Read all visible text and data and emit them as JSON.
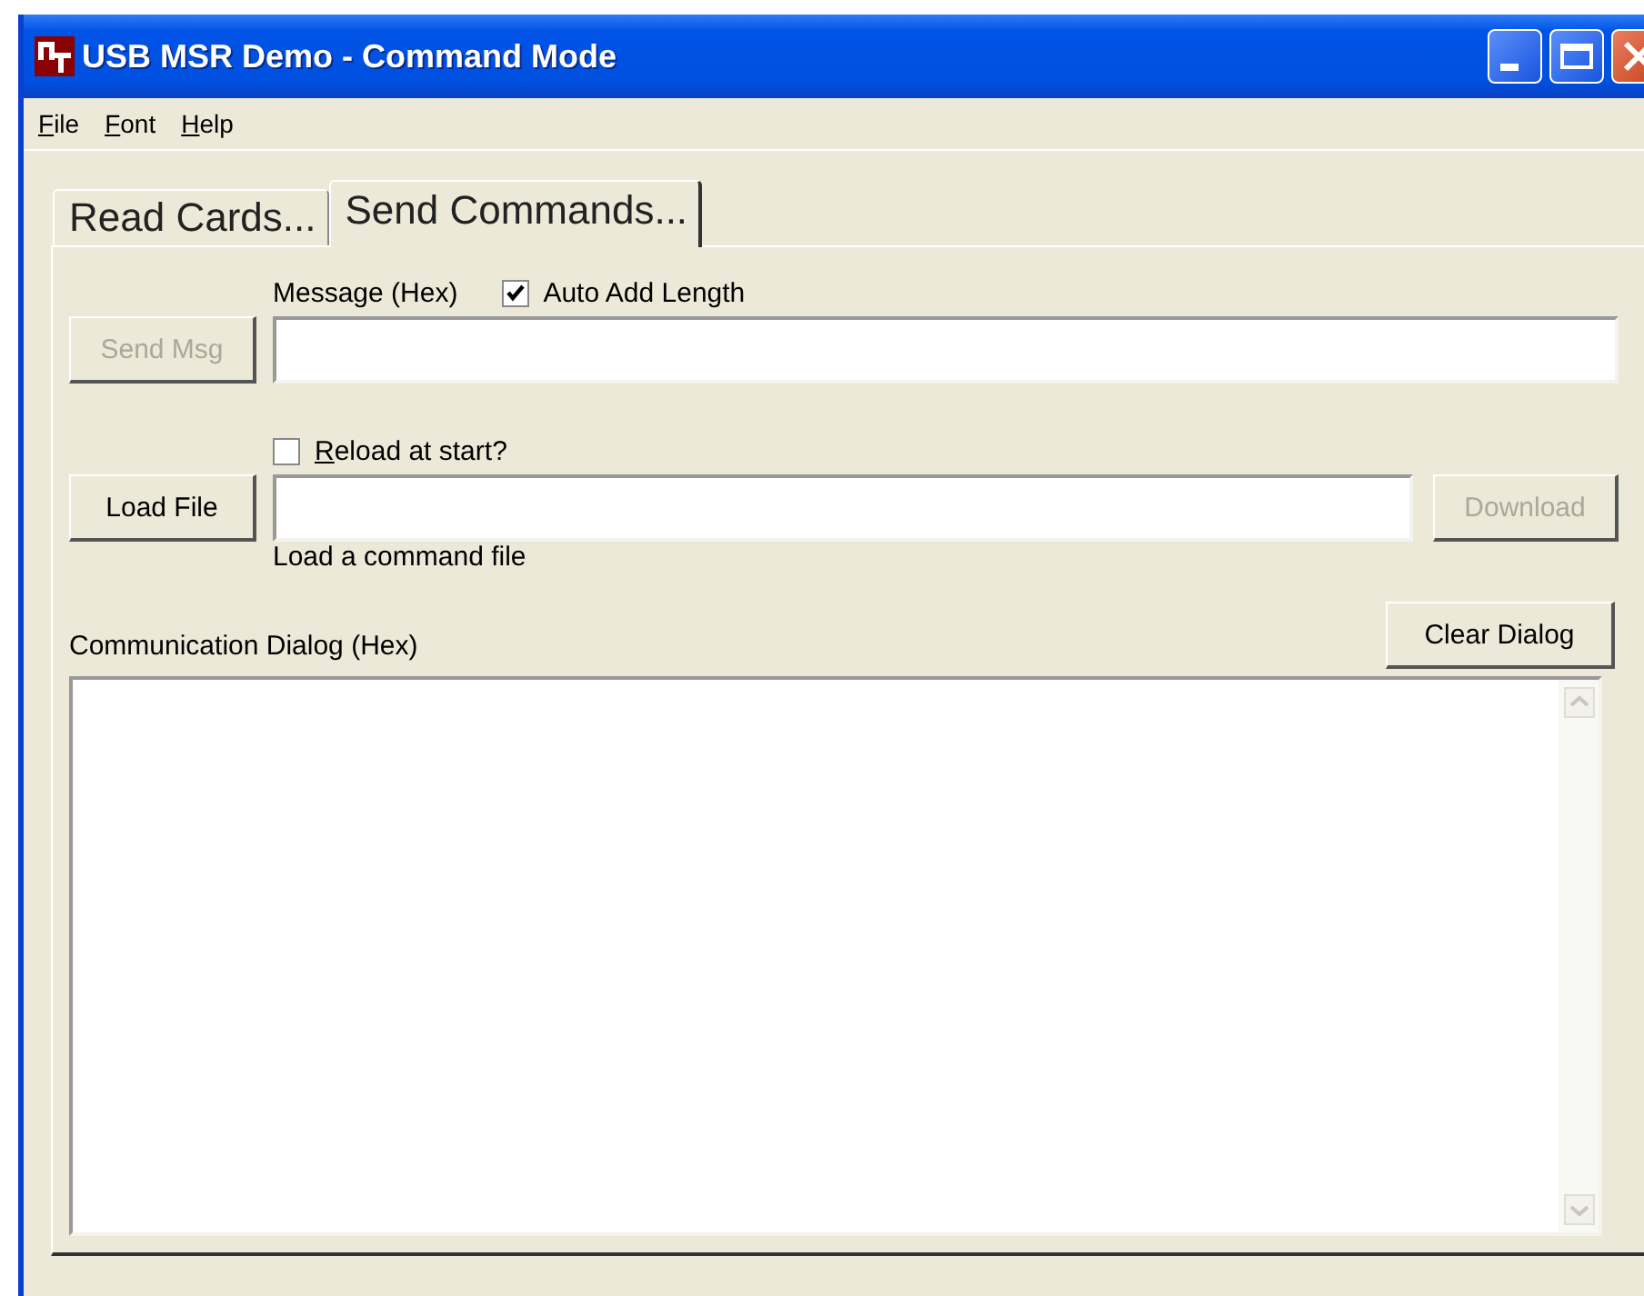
{
  "window": {
    "title": "USB MSR Demo - Command Mode"
  },
  "menu": [
    {
      "label": "File"
    },
    {
      "label": "Font"
    },
    {
      "label": "Help"
    }
  ],
  "tabs": [
    {
      "label": "Read Cards...",
      "selected": false
    },
    {
      "label": "Send Commands...",
      "selected": true
    }
  ],
  "message": {
    "label": "Message (Hex)",
    "auto_add_length": {
      "label": "Auto Add Length",
      "checked": true
    },
    "send_button": {
      "label": "Send Msg",
      "disabled": true
    }
  },
  "load": {
    "reload_at_start": {
      "label": "Reload at start?",
      "checked": false
    },
    "load_button": {
      "label": "Load File",
      "disabled": false
    },
    "download_button": {
      "label": "Download",
      "disabled": true
    },
    "hint": "Load a command file"
  },
  "dialog": {
    "label": "Communication Dialog (Hex)",
    "clear_button": {
      "label": "Clear Dialog",
      "disabled": false
    }
  }
}
